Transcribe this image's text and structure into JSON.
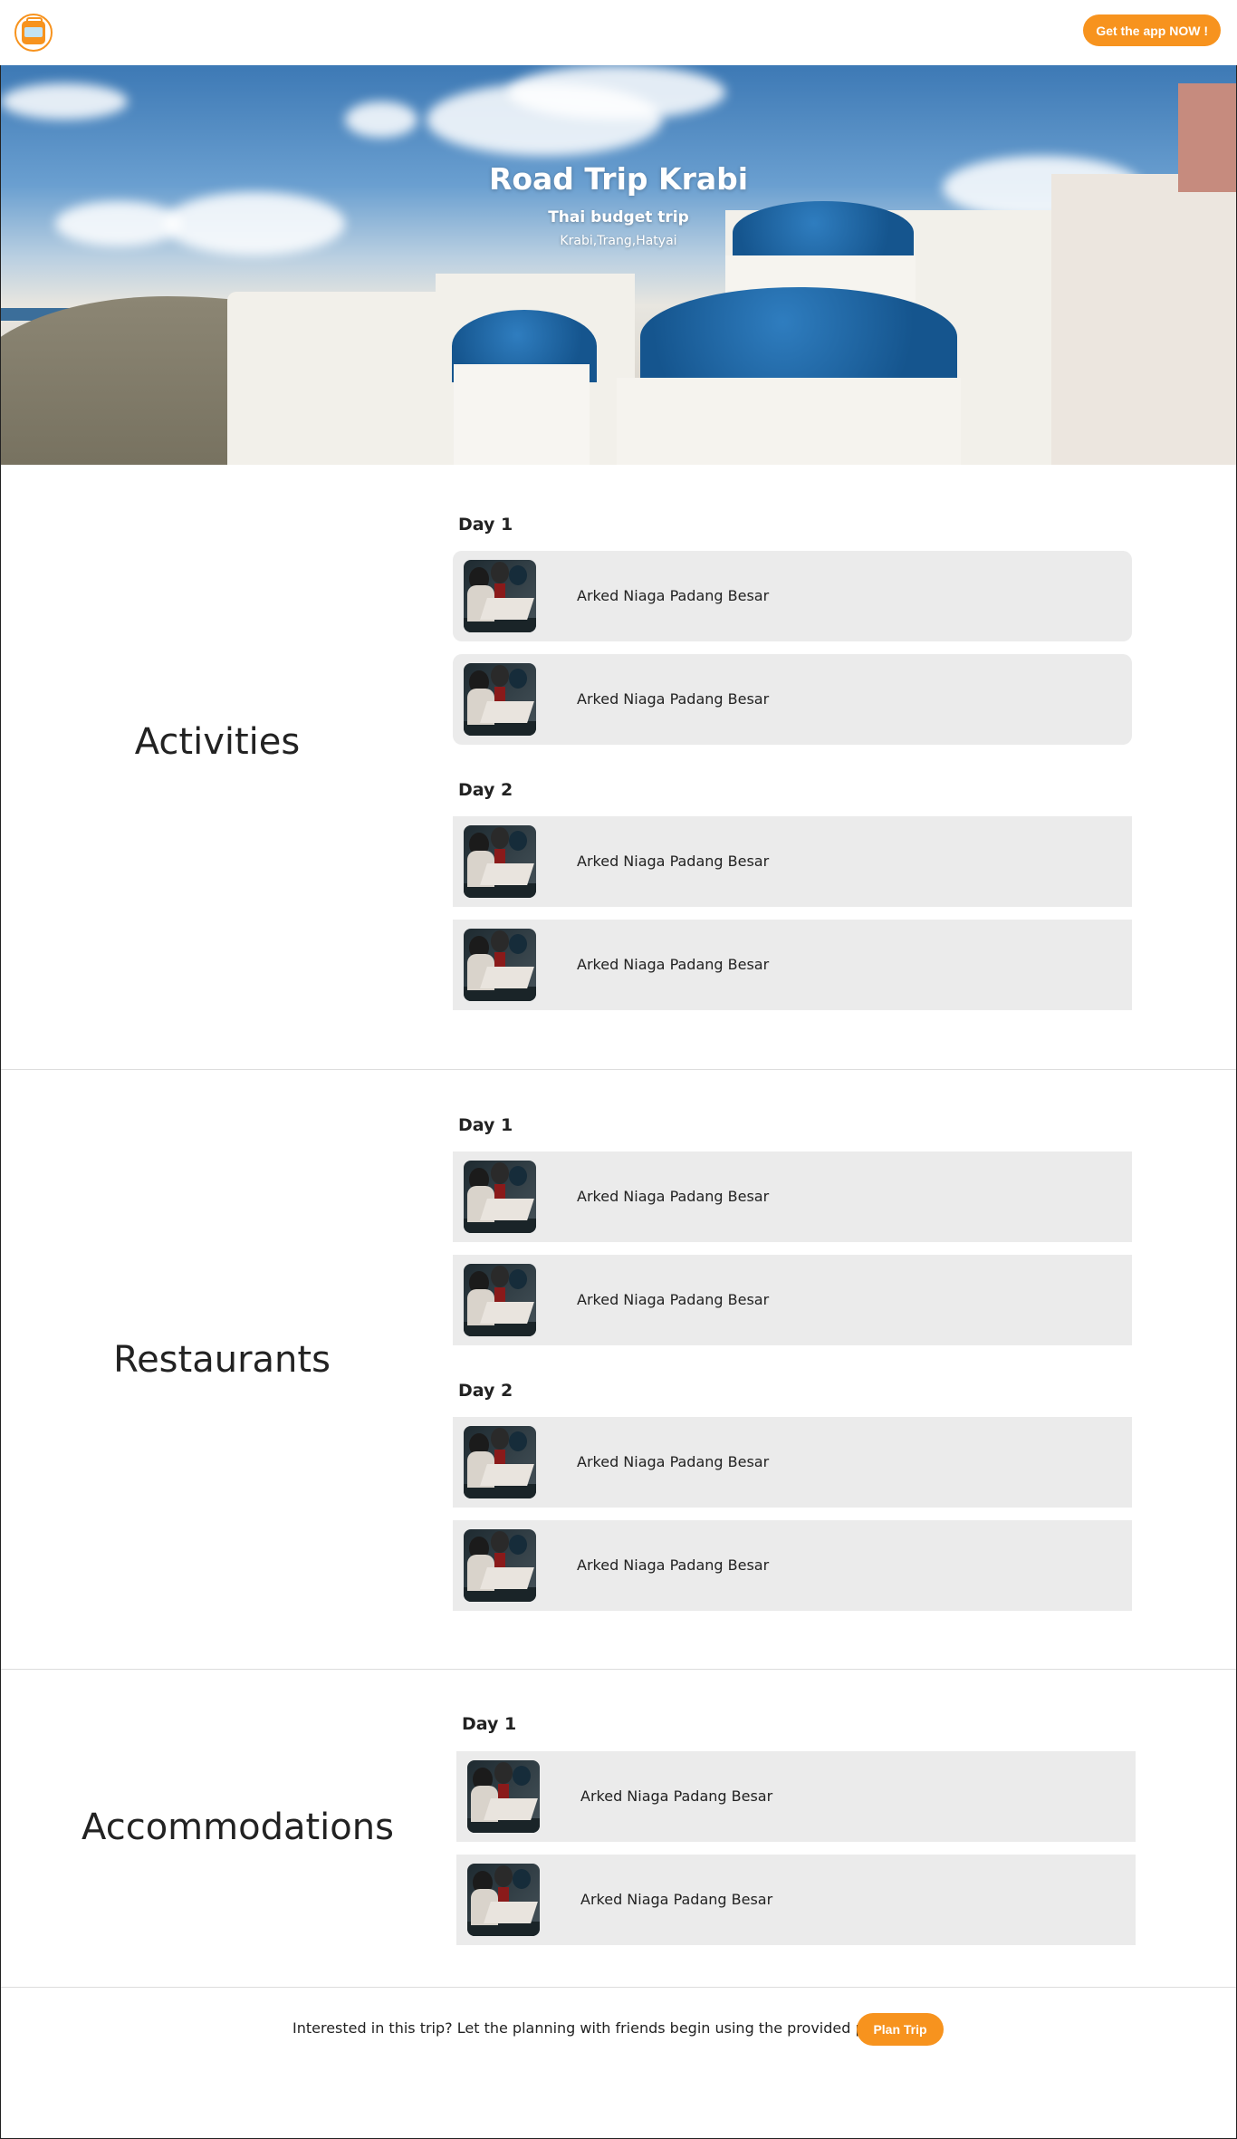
{
  "header": {
    "logo": "suitcase-logo",
    "app_button": "Get the app NOW !"
  },
  "hero": {
    "title": "Road Trip Krabi",
    "subtitle": "Thai budget trip",
    "locations": "Krabi,Trang,Hatyai"
  },
  "sections": [
    {
      "title": "Activities",
      "days": [
        {
          "label": "Day 1",
          "items": [
            "Arked Niaga Padang Besar",
            "Arked Niaga Padang Besar"
          ]
        },
        {
          "label": "Day 2",
          "items": [
            "Arked Niaga Padang Besar",
            "Arked Niaga Padang Besar"
          ]
        }
      ]
    },
    {
      "title": "Restaurants",
      "days": [
        {
          "label": "Day 1",
          "items": [
            "Arked Niaga Padang Besar",
            "Arked Niaga Padang Besar"
          ]
        },
        {
          "label": "Day 2",
          "items": [
            "Arked Niaga Padang Besar",
            "Arked Niaga Padang Besar"
          ]
        }
      ]
    },
    {
      "title": "Accommodations",
      "days": [
        {
          "label": "Day 1",
          "items": [
            "Arked Niaga Padang Besar",
            "Arked Niaga Padang Besar"
          ]
        }
      ]
    }
  ],
  "footer": {
    "cta_text": "Interested in this trip? Let the planning with friends begin using the provided plan!",
    "plan_button": "Plan Trip"
  },
  "colors": {
    "accent": "#f7931e",
    "card_bg": "#ebebeb"
  }
}
